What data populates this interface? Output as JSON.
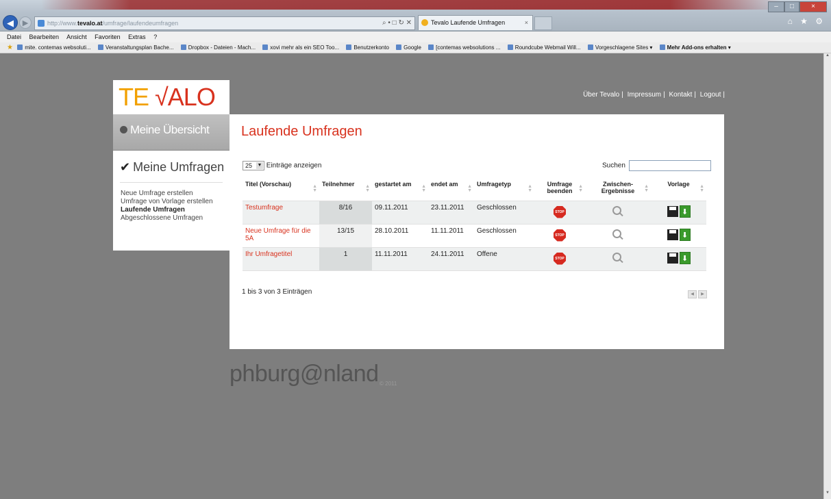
{
  "browser": {
    "url_prefix": "http://www.",
    "url_host": "tevalo.at",
    "url_path": "/umfrage/laufendeumfragen",
    "address_tools": "⌕ • □ ↻ ✕",
    "tab_title": "Tevalo Laufende Umfragen",
    "tab_close": "×",
    "right_glyphs": "⌂ ★ ⚙",
    "window_min": "–",
    "window_max": "□",
    "window_close": "×"
  },
  "menubar": [
    "Datei",
    "Bearbeiten",
    "Ansicht",
    "Favoriten",
    "Extras",
    "?"
  ],
  "favorites": [
    "mite. contemas websoluti...",
    "Veranstaltungsplan Bache...",
    "Dropbox - Dateien - Mach...",
    "xovi mehr als ein SEO Too...",
    "Benutzerkonto",
    "Google",
    "[contemas websolutions ...",
    "Roundcube Webmail Will...",
    "Vorgeschlagene Sites ▾"
  ],
  "favorites_more": "Mehr Add-ons erhalten ▾",
  "logo": {
    "te": "TE ",
    "check": "√",
    "valo": "ALO"
  },
  "toplinks": [
    "Über Tevalo",
    "Impressum",
    "Kontakt",
    "Logout"
  ],
  "sidebar": {
    "overview": "Meine Übersicht",
    "heading_tick": "✔",
    "heading": "Meine Umfragen",
    "items": [
      "Neue Umfrage erstellen",
      "Umfrage von Vorlage erstellen",
      "Laufende Umfragen",
      "Abgeschlossene Umfragen"
    ]
  },
  "main": {
    "title": "Laufende Umfragen",
    "length_value": "25",
    "length_label": "Einträge anzeigen",
    "search_label": "Suchen",
    "columns": [
      "Titel (Vorschau)",
      "Teilnehmer",
      "gestartet am",
      "endet am",
      "Umfragetyp",
      "Umfrage beenden",
      "Zwischen-Ergebnisse",
      "Vorlage"
    ],
    "rows": [
      {
        "title": "Testumfrage",
        "teilnehmer": "8/16",
        "start": "09.11.2011",
        "end": "23.11.2011",
        "typ": "Geschlossen"
      },
      {
        "title": "Neue Umfrage für die 5A",
        "teilnehmer": "13/15",
        "start": "28.10.2011",
        "end": "11.11.2011",
        "typ": "Geschlossen"
      },
      {
        "title": "Ihr Umfragetitel",
        "teilnehmer": "1",
        "start": "11.11.2011",
        "end": "24.11.2011",
        "typ": "Offene"
      }
    ],
    "stop_label": "STOP",
    "info": "1 bis 3 von 3 Einträgen"
  },
  "footer": {
    "logo": "phburg@nland",
    "copy": "© 2011"
  }
}
